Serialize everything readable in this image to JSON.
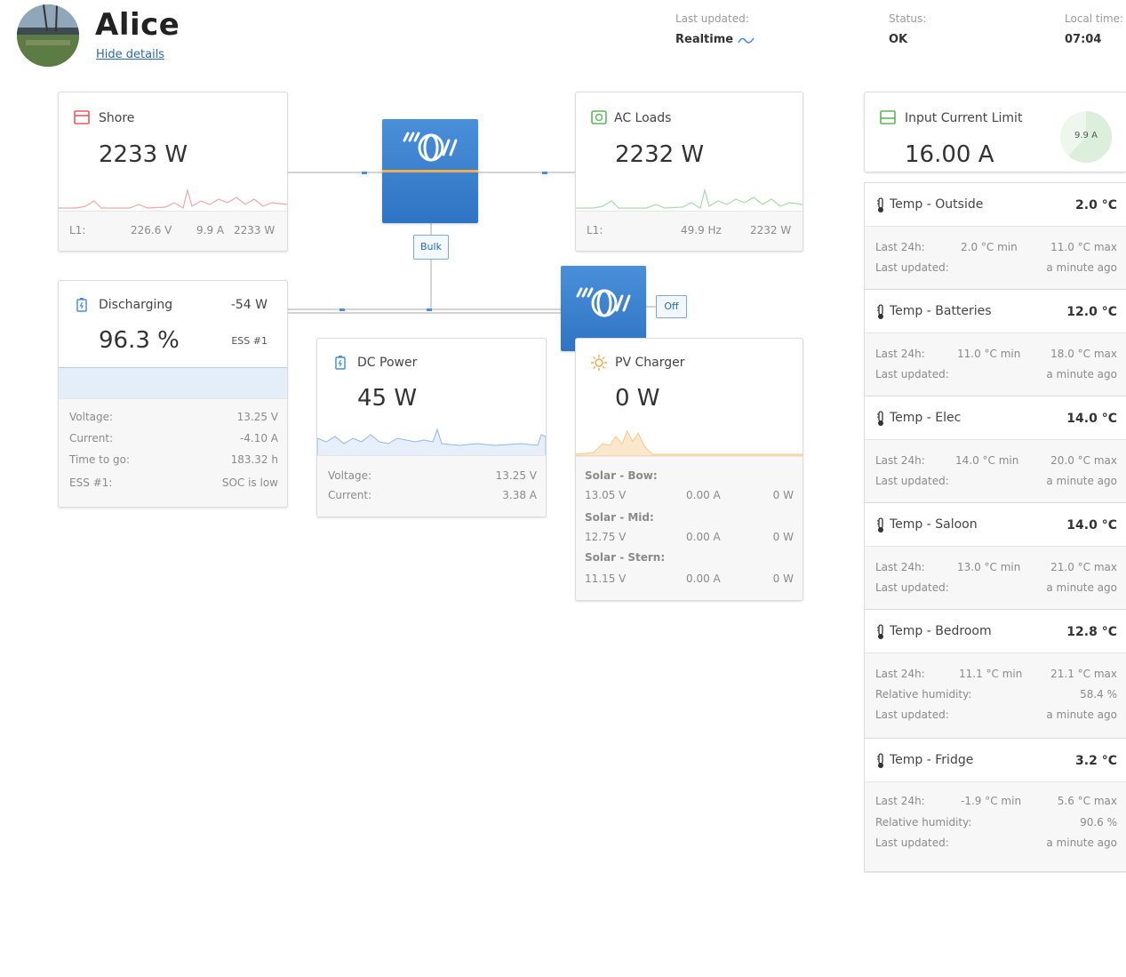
{
  "header": {
    "site_name": "Alice",
    "hide_details": "Hide details",
    "last_updated_label": "Last updated:",
    "last_updated_value": "Realtime",
    "status_label": "Status:",
    "status_value": "OK",
    "local_time_label": "Local time:",
    "local_time_value": "07:04"
  },
  "shore": {
    "title": "Shore",
    "power": "2233 W",
    "phase": "L1:",
    "voltage": "226.6 V",
    "current": "9.9 A",
    "phase_power": "2233 W"
  },
  "ac_loads": {
    "title": "AC Loads",
    "power": "2232 W",
    "phase": "L1:",
    "frequency": "49.9 Hz",
    "phase_power": "2232 W"
  },
  "inverter": {
    "state": "Bulk"
  },
  "solar_device": {
    "state": "Off"
  },
  "battery": {
    "title": "Discharging",
    "power": "-54 W",
    "soc": "96.3 %",
    "ess": "ESS #1",
    "rows": [
      {
        "label": "Voltage:",
        "value": "13.25 V"
      },
      {
        "label": "Current:",
        "value": "-4.10 A"
      },
      {
        "label": "Time to go:",
        "value": "183.32 h"
      },
      {
        "label": "ESS #1:",
        "value": "SOC is low"
      }
    ]
  },
  "dc_power": {
    "title": "DC Power",
    "power": "45 W",
    "rows": [
      {
        "label": "Voltage:",
        "value": "13.25 V"
      },
      {
        "label": "Current:",
        "value": "3.38 A"
      }
    ]
  },
  "pv_charger": {
    "title": "PV Charger",
    "power": "0 W",
    "chargers": [
      {
        "name": "Solar - Bow:",
        "voltage": "13.05 V",
        "current": "0.00 A",
        "power": "0 W"
      },
      {
        "name": "Solar - Mid:",
        "voltage": "12.75 V",
        "current": "0.00 A",
        "power": "0 W"
      },
      {
        "name": "Solar - Stern:",
        "voltage": "11.15 V",
        "current": "0.00 A",
        "power": "0 W"
      }
    ]
  },
  "input_limit": {
    "title": "Input Current Limit",
    "value": "16.00 A",
    "gauge_label": "9.9 A",
    "gauge_fraction": 0.62
  },
  "temps": [
    {
      "title": "Temp - Outside",
      "value": "2.0 °C",
      "last24_label": "Last 24h:",
      "min": "2.0 °C min",
      "max": "11.0 °C max",
      "humidity_label": "",
      "humidity": "",
      "updated_label": "Last updated:",
      "updated": "a minute ago"
    },
    {
      "title": "Temp - Batteries",
      "value": "12.0 °C",
      "last24_label": "Last 24h:",
      "min": "11.0 °C min",
      "max": "18.0 °C max",
      "humidity_label": "",
      "humidity": "",
      "updated_label": "Last updated:",
      "updated": "a minute ago"
    },
    {
      "title": "Temp - Elec",
      "value": "14.0 °C",
      "last24_label": "Last 24h:",
      "min": "14.0 °C min",
      "max": "20.0 °C max",
      "humidity_label": "",
      "humidity": "",
      "updated_label": "Last updated:",
      "updated": "a minute ago"
    },
    {
      "title": "Temp - Saloon",
      "value": "14.0 °C",
      "last24_label": "Last 24h:",
      "min": "13.0 °C min",
      "max": "21.0 °C max",
      "humidity_label": "",
      "humidity": "",
      "updated_label": "Last updated:",
      "updated": "a minute ago"
    },
    {
      "title": "Temp - Bedroom",
      "value": "12.8 °C",
      "last24_label": "Last 24h:",
      "min": "11.1 °C min",
      "max": "21.1 °C max",
      "humidity_label": "Relative humidity:",
      "humidity": "58.4 %",
      "updated_label": "Last updated:",
      "updated": "a minute ago"
    },
    {
      "title": "Temp - Fridge",
      "value": "3.2 °C",
      "last24_label": "Last 24h:",
      "min": "-1.9 °C min",
      "max": "5.6 °C max",
      "humidity_label": "Relative humidity:",
      "humidity": "90.6 %",
      "updated_label": "Last updated:",
      "updated": "a minute ago"
    }
  ],
  "colors": {
    "shore": "#e9595f",
    "ac": "#5cb85c",
    "battery": "#4a90d9",
    "pv": "#f0ad4e",
    "victron_blue": "#2f74c4"
  },
  "icons": {
    "shore": "shore-plug-icon",
    "ac": "ac-loads-icon",
    "battery": "battery-icon",
    "pv": "sun-icon",
    "temp": "thermometer-icon"
  }
}
